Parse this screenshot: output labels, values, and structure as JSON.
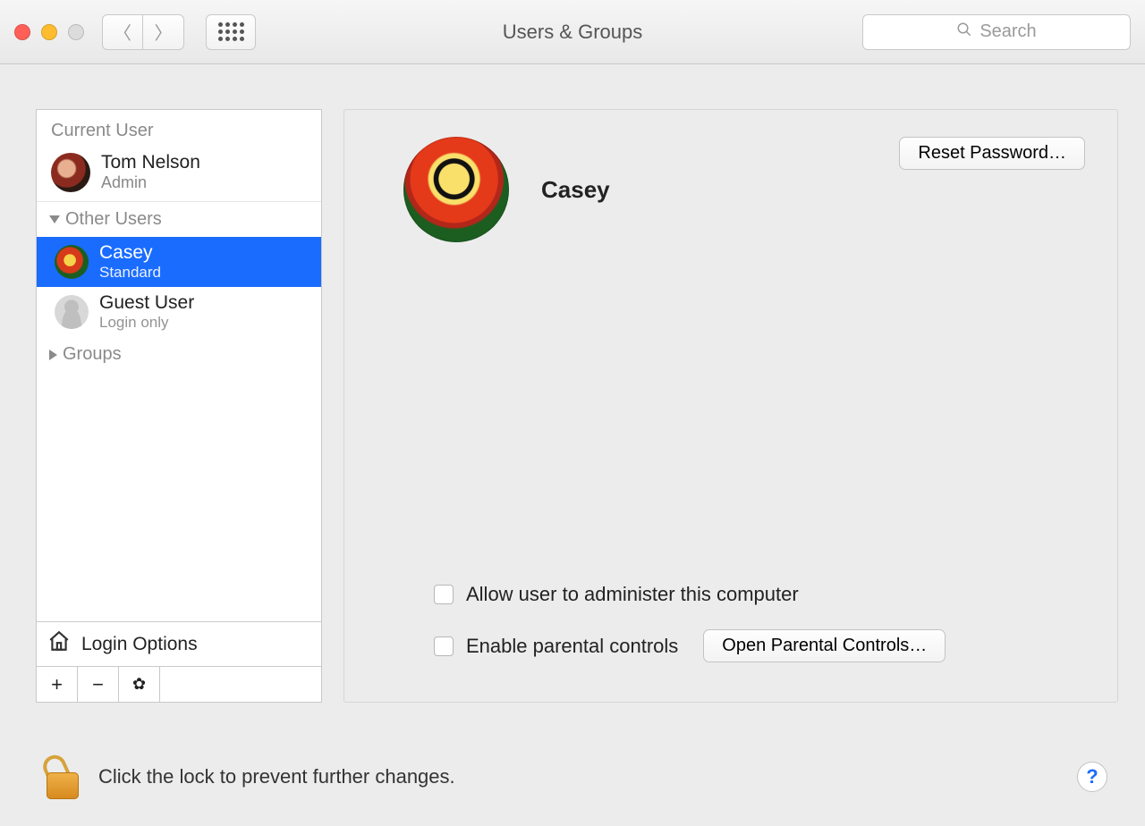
{
  "window": {
    "title": "Users & Groups",
    "search_placeholder": "Search"
  },
  "sidebar": {
    "current_user_label": "Current User",
    "current_user": {
      "name": "Tom Nelson",
      "role": "Admin"
    },
    "other_users_label": "Other Users",
    "other_users": [
      {
        "name": "Casey",
        "role": "Standard",
        "selected": true
      },
      {
        "name": "Guest User",
        "role": "Login only",
        "selected": false
      }
    ],
    "groups_label": "Groups",
    "login_options_label": "Login Options"
  },
  "detail": {
    "user_name": "Casey",
    "reset_password_label": "Reset Password…",
    "allow_admin_label": "Allow user to administer this computer",
    "allow_admin_checked": false,
    "enable_parental_label": "Enable parental controls",
    "enable_parental_checked": false,
    "open_parental_label": "Open Parental Controls…"
  },
  "footer": {
    "lock_text": "Click the lock to prevent further changes.",
    "help_label": "?"
  }
}
